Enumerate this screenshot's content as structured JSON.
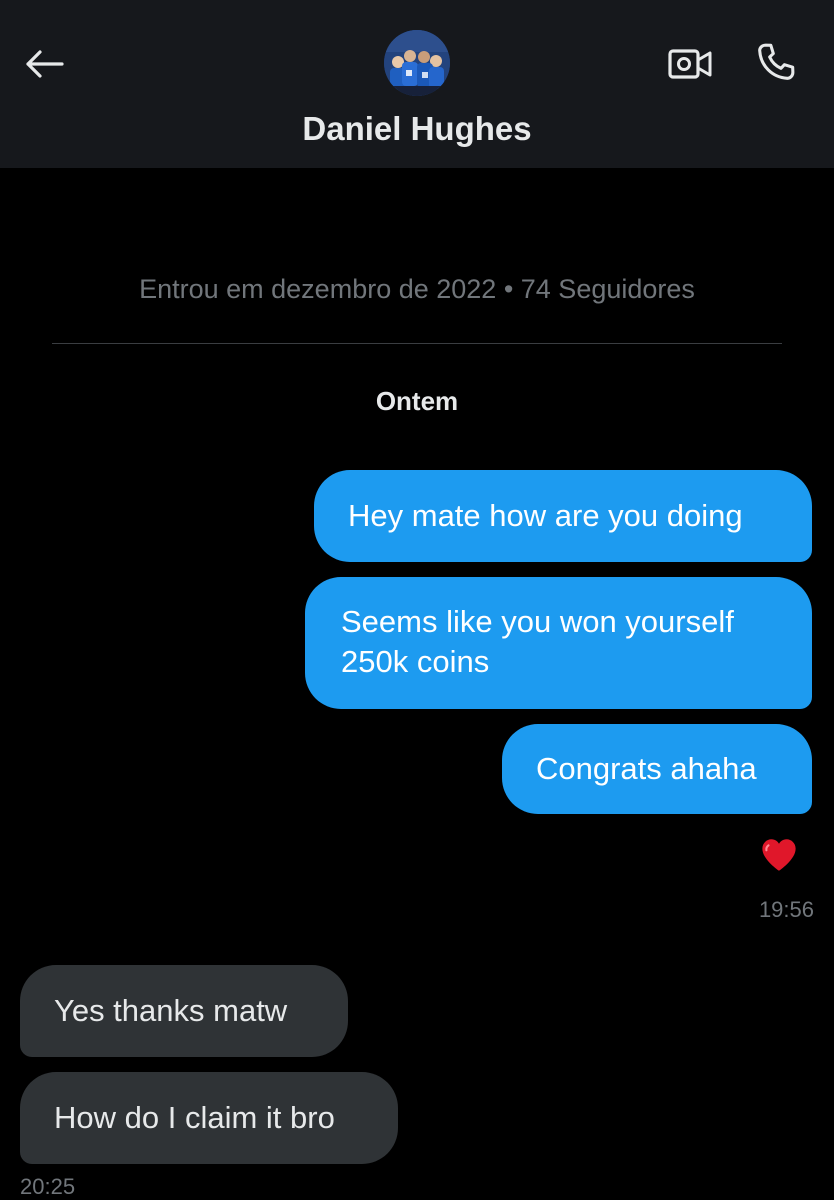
{
  "header": {
    "contact_name": "Daniel Hughes",
    "back_icon": "arrow-left-icon",
    "video_icon": "video-camera-icon",
    "call_icon": "phone-icon"
  },
  "profile": {
    "meta": "Entrou em dezembro de 2022 • 74 Seguidores"
  },
  "conversation": {
    "date_separator": "Ontem",
    "messages": [
      {
        "direction": "sent",
        "text": "Hey mate how are you doing"
      },
      {
        "direction": "sent",
        "text": "Seems like you won yourself 250k coins"
      },
      {
        "direction": "sent",
        "text": "Congrats ahaha"
      },
      {
        "direction": "received",
        "text": "Yes thanks matw"
      },
      {
        "direction": "received",
        "text": "How do I claim it bro"
      }
    ],
    "sent_reaction": "❤️",
    "sent_timestamp": "19:56",
    "received_timestamp": "20:25"
  },
  "colors": {
    "sent_bubble": "#1d9bf0",
    "received_bubble": "#2f3336",
    "header_bg": "#16181c",
    "secondary_text": "#71767b"
  }
}
